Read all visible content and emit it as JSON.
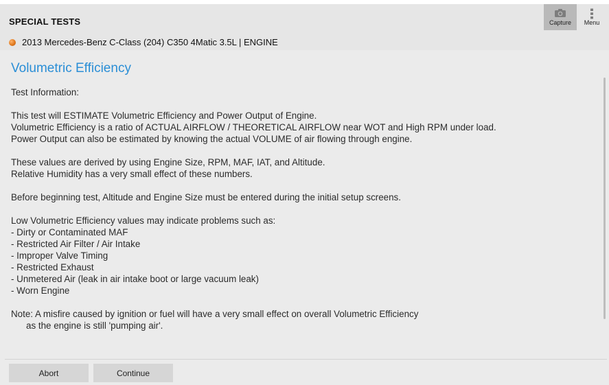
{
  "header": {
    "title": "SPECIAL TESTS",
    "vehicle": "2013 Mercedes-Benz C-Class (204) C350 4Matic 3.5L | ENGINE",
    "capture_label": "Capture",
    "menu_label": "Menu"
  },
  "content": {
    "section_title": "Volumetric Efficiency",
    "info_heading": "Test Information:",
    "para1": [
      "This test will ESTIMATE Volumetric Efficiency and Power Output of Engine.",
      "Volumetric Efficiency is a ratio of ACTUAL AIRFLOW / THEORETICAL AIRFLOW near WOT and High RPM under load.",
      "Power Output can also be estimated by knowing the actual VOLUME of air flowing through engine."
    ],
    "para2": [
      "These values are derived by using Engine Size, RPM, MAF, IAT, and Altitude.",
      "Relative Humidity has a very small effect of these numbers."
    ],
    "para3": "Before beginning test, Altitude and Engine Size must be entered during the initial setup screens.",
    "problems_heading": "Low Volumetric Efficiency values may indicate problems such as:",
    "problems": [
      " - Dirty or Contaminated MAF",
      " - Restricted Air Filter / Air Intake",
      " - Improper Valve Timing",
      " - Restricted Exhaust",
      " - Unmetered Air (leak in air intake boot or large vacuum leak)",
      " - Worn Engine"
    ],
    "note_line1": "Note: A misfire caused by ignition or fuel will have a very small effect on overall Volumetric Efficiency",
    "note_line2": "as the engine is still 'pumping air'."
  },
  "footer": {
    "abort_label": "Abort",
    "continue_label": "Continue"
  },
  "colors": {
    "accent": "#2a8ed6",
    "background": "#ebebeb",
    "button": "#d6d6d6"
  },
  "icons": {
    "capture": "camera-icon",
    "menu": "more-vert-icon",
    "vehicle": "status-dot-icon"
  }
}
